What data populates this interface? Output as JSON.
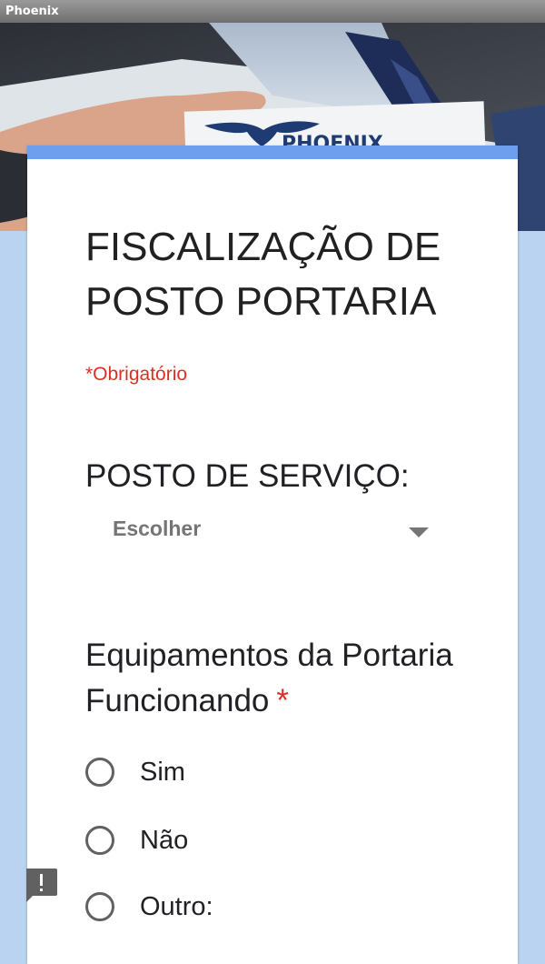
{
  "window": {
    "title": "Phoenix"
  },
  "header": {
    "logo_text": "PHOENIX",
    "image_alt": "business handshake with Phoenix logo card"
  },
  "form": {
    "title": "FISCALIZAÇÃO DE POSTO PORTARIA",
    "required_note": "*Obrigatório",
    "accent_color": "#6e9ef0",
    "background_color": "#b9d3f0"
  },
  "questions": [
    {
      "title": "POSTO DE SERVIÇO:",
      "type": "dropdown",
      "selected": "Escolher"
    },
    {
      "title": "Equipamentos da Portaria Funcionando",
      "required_mark": "*",
      "type": "radio",
      "options": [
        "Sim",
        "Não",
        "Outro:"
      ]
    }
  ],
  "icons": {
    "dropdown": "chevron-down-icon",
    "feedback": "feedback-icon"
  }
}
